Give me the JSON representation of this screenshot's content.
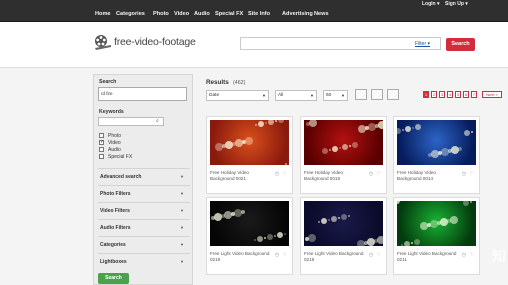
{
  "nav": {
    "items": [
      "Home",
      "Categories",
      "Photo",
      "Video",
      "Audio",
      "Special FX",
      "Site Info",
      "Advertising",
      "News"
    ],
    "login": "Login ▾",
    "signup": "Sign Up ▾"
  },
  "header": {
    "logo": "free-video-footage",
    "filter_link": "Filter ▾",
    "search_button": "Search",
    "search_value": ""
  },
  "sidebar": {
    "search_label": "Search",
    "search_value": "rd fire",
    "keywords_label": "Keywords",
    "types": [
      {
        "label": "Photo",
        "checked": false
      },
      {
        "label": "Video",
        "checked": true
      },
      {
        "label": "Audio",
        "checked": false
      },
      {
        "label": "Special FX",
        "checked": false
      }
    ],
    "filters": [
      "Advanced search",
      "Photo Filters",
      "Video Filters",
      "Audio Filters",
      "Categories",
      "Lightboxes"
    ],
    "go_button": "Search"
  },
  "results": {
    "title": "Results",
    "count": "(462)",
    "sort": "Date",
    "type": "All",
    "per_page": "50",
    "pages": [
      "1",
      "2",
      "3",
      "4",
      "5",
      "6",
      "7"
    ],
    "next": "Next »",
    "cards": [
      {
        "title": "Free Holiday Video Background 0021",
        "colors": [
          "#8b1a0e",
          "#d9501b"
        ]
      },
      {
        "title": "Free Holiday Video Background 0019",
        "colors": [
          "#5a0000",
          "#b31111"
        ]
      },
      {
        "title": "Free Holiday Video Background 0014",
        "colors": [
          "#061c5c",
          "#2d64c7"
        ]
      },
      {
        "title": "Free Light Video Background 0219",
        "colors": [
          "#050505",
          "#1a1a1a"
        ]
      },
      {
        "title": "Free Light Video Background 0218",
        "colors": [
          "#0a0a2a",
          "#1a1a4a"
        ]
      },
      {
        "title": "Free Light Video Background 0211",
        "colors": [
          "#033a0e",
          "#19b132"
        ]
      }
    ]
  },
  "watermark": "知"
}
